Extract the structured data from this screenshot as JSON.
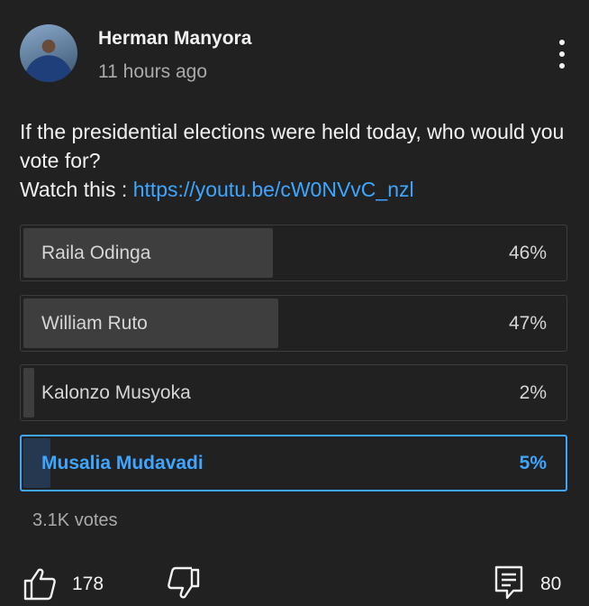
{
  "header": {
    "author": "Herman Manyora",
    "time": "11 hours ago"
  },
  "post": {
    "question": "If the presidential elections were held today, who would you vote for?",
    "watch_label": "Watch this :",
    "link": "https://youtu.be/cW0NVvC_nzl"
  },
  "poll": {
    "options": [
      {
        "label": "Raila Odinga",
        "percent": "46%",
        "share": 0.46,
        "selected": false
      },
      {
        "label": "William Ruto",
        "percent": "47%",
        "share": 0.47,
        "selected": false
      },
      {
        "label": "Kalonzo Musyoka",
        "percent": "2%",
        "share": 0.02,
        "selected": false
      },
      {
        "label": "Musalia Mudavadi",
        "percent": "5%",
        "share": 0.05,
        "selected": true
      }
    ],
    "votes": "3.1K votes"
  },
  "actions": {
    "likes": "178",
    "comments": "80"
  },
  "colors": {
    "background": "#212121",
    "accent": "#3ea6ff",
    "secondary_text": "#aaaaaa"
  },
  "icons": {
    "like": "thumbs-up-icon",
    "dislike": "thumbs-down-icon",
    "comment": "comment-icon",
    "menu": "more-vert-icon"
  }
}
